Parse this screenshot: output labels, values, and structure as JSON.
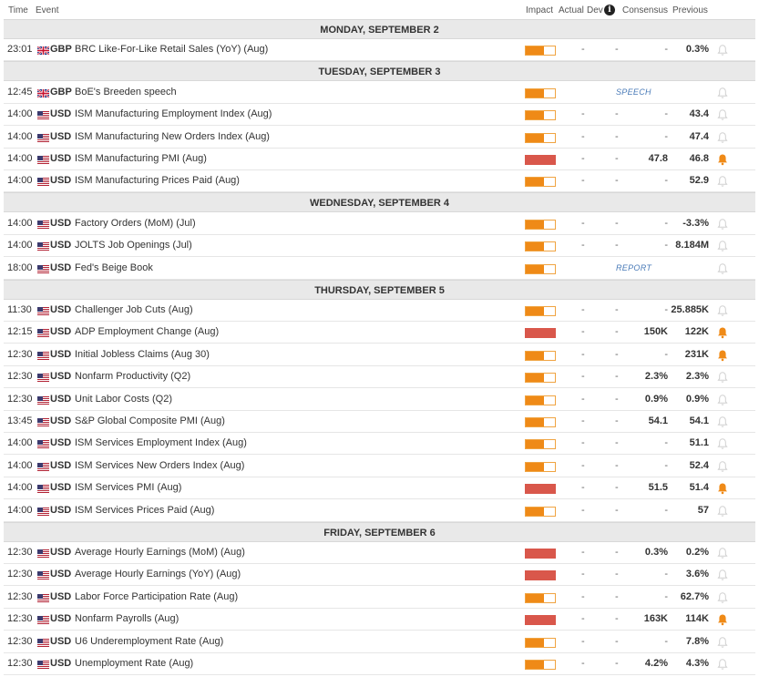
{
  "header": {
    "time": "Time",
    "event": "Event",
    "impact": "Impact",
    "actual": "Actual",
    "dev": "Dev",
    "consensus": "Consensus",
    "previous": "Previous",
    "info_icon": "i"
  },
  "colors": {
    "impact_medium": "#ef8a17",
    "impact_high": "#d9574b",
    "bell_active": "#ef8a17",
    "bell_inactive": "#d0d0d0",
    "tag_text": "#4a7bb8"
  },
  "days": [
    {
      "label": "MONDAY, SEPTEMBER 2",
      "events": [
        {
          "time": "23:01",
          "currency": "GBP",
          "flag": "uk-flag-icon",
          "event": "BRC Like-For-Like Retail Sales (YoY) (Aug)",
          "impact": "medium",
          "actual": "-",
          "dev": "-",
          "consensus": "-",
          "previous": "0.3%",
          "alert": false
        }
      ]
    },
    {
      "label": "TUESDAY, SEPTEMBER 3",
      "events": [
        {
          "time": "12:45",
          "currency": "GBP",
          "flag": "uk-flag-icon",
          "event": "BoE's Breeden speech",
          "impact": "medium",
          "tag": "SPEECH",
          "alert": false
        },
        {
          "time": "14:00",
          "currency": "USD",
          "flag": "us-flag-icon",
          "event": "ISM Manufacturing Employment Index (Aug)",
          "impact": "medium",
          "actual": "-",
          "dev": "-",
          "consensus": "-",
          "previous": "43.4",
          "alert": false
        },
        {
          "time": "14:00",
          "currency": "USD",
          "flag": "us-flag-icon",
          "event": "ISM Manufacturing New Orders Index (Aug)",
          "impact": "medium",
          "actual": "-",
          "dev": "-",
          "consensus": "-",
          "previous": "47.4",
          "alert": false
        },
        {
          "time": "14:00",
          "currency": "USD",
          "flag": "us-flag-icon",
          "event": "ISM Manufacturing PMI (Aug)",
          "impact": "high",
          "actual": "-",
          "dev": "-",
          "consensus": "47.8",
          "previous": "46.8",
          "alert": true
        },
        {
          "time": "14:00",
          "currency": "USD",
          "flag": "us-flag-icon",
          "event": "ISM Manufacturing Prices Paid (Aug)",
          "impact": "medium",
          "actual": "-",
          "dev": "-",
          "consensus": "-",
          "previous": "52.9",
          "alert": false
        }
      ]
    },
    {
      "label": "WEDNESDAY, SEPTEMBER 4",
      "events": [
        {
          "time": "14:00",
          "currency": "USD",
          "flag": "us-flag-icon",
          "event": "Factory Orders (MoM) (Jul)",
          "impact": "medium",
          "actual": "-",
          "dev": "-",
          "consensus": "-",
          "previous": "-3.3%",
          "alert": false
        },
        {
          "time": "14:00",
          "currency": "USD",
          "flag": "us-flag-icon",
          "event": "JOLTS Job Openings (Jul)",
          "impact": "medium",
          "actual": "-",
          "dev": "-",
          "consensus": "-",
          "previous": "8.184M",
          "alert": false
        },
        {
          "time": "18:00",
          "currency": "USD",
          "flag": "us-flag-icon",
          "event": "Fed's Beige Book",
          "impact": "medium",
          "tag": "REPORT",
          "alert": false
        }
      ]
    },
    {
      "label": "THURSDAY, SEPTEMBER 5",
      "events": [
        {
          "time": "11:30",
          "currency": "USD",
          "flag": "us-flag-icon",
          "event": "Challenger Job Cuts (Aug)",
          "impact": "medium",
          "actual": "-",
          "dev": "-",
          "consensus": "-",
          "previous": "25.885K",
          "alert": false
        },
        {
          "time": "12:15",
          "currency": "USD",
          "flag": "us-flag-icon",
          "event": "ADP Employment Change (Aug)",
          "impact": "high",
          "actual": "-",
          "dev": "-",
          "consensus": "150K",
          "previous": "122K",
          "alert": true
        },
        {
          "time": "12:30",
          "currency": "USD",
          "flag": "us-flag-icon",
          "event": "Initial Jobless Claims (Aug 30)",
          "impact": "medium",
          "actual": "-",
          "dev": "-",
          "consensus": "-",
          "previous": "231K",
          "alert": true
        },
        {
          "time": "12:30",
          "currency": "USD",
          "flag": "us-flag-icon",
          "event": "Nonfarm Productivity (Q2)",
          "impact": "medium",
          "actual": "-",
          "dev": "-",
          "consensus": "2.3%",
          "previous": "2.3%",
          "alert": false
        },
        {
          "time": "12:30",
          "currency": "USD",
          "flag": "us-flag-icon",
          "event": "Unit Labor Costs (Q2)",
          "impact": "medium",
          "actual": "-",
          "dev": "-",
          "consensus": "0.9%",
          "previous": "0.9%",
          "alert": false
        },
        {
          "time": "13:45",
          "currency": "USD",
          "flag": "us-flag-icon",
          "event": "S&P Global Composite PMI (Aug)",
          "impact": "medium",
          "actual": "-",
          "dev": "-",
          "consensus": "54.1",
          "previous": "54.1",
          "alert": false
        },
        {
          "time": "14:00",
          "currency": "USD",
          "flag": "us-flag-icon",
          "event": "ISM Services Employment Index (Aug)",
          "impact": "medium",
          "actual": "-",
          "dev": "-",
          "consensus": "-",
          "previous": "51.1",
          "alert": false
        },
        {
          "time": "14:00",
          "currency": "USD",
          "flag": "us-flag-icon",
          "event": "ISM Services New Orders Index (Aug)",
          "impact": "medium",
          "actual": "-",
          "dev": "-",
          "consensus": "-",
          "previous": "52.4",
          "alert": false
        },
        {
          "time": "14:00",
          "currency": "USD",
          "flag": "us-flag-icon",
          "event": "ISM Services PMI (Aug)",
          "impact": "high",
          "actual": "-",
          "dev": "-",
          "consensus": "51.5",
          "previous": "51.4",
          "alert": true
        },
        {
          "time": "14:00",
          "currency": "USD",
          "flag": "us-flag-icon",
          "event": "ISM Services Prices Paid (Aug)",
          "impact": "medium",
          "actual": "-",
          "dev": "-",
          "consensus": "-",
          "previous": "57",
          "alert": false
        }
      ]
    },
    {
      "label": "FRIDAY, SEPTEMBER 6",
      "events": [
        {
          "time": "12:30",
          "currency": "USD",
          "flag": "us-flag-icon",
          "event": "Average Hourly Earnings (MoM) (Aug)",
          "impact": "high",
          "actual": "-",
          "dev": "-",
          "consensus": "0.3%",
          "previous": "0.2%",
          "alert": false
        },
        {
          "time": "12:30",
          "currency": "USD",
          "flag": "us-flag-icon",
          "event": "Average Hourly Earnings (YoY) (Aug)",
          "impact": "high",
          "actual": "-",
          "dev": "-",
          "consensus": "-",
          "previous": "3.6%",
          "alert": false
        },
        {
          "time": "12:30",
          "currency": "USD",
          "flag": "us-flag-icon",
          "event": "Labor Force Participation Rate (Aug)",
          "impact": "medium",
          "actual": "-",
          "dev": "-",
          "consensus": "-",
          "previous": "62.7%",
          "alert": false
        },
        {
          "time": "12:30",
          "currency": "USD",
          "flag": "us-flag-icon",
          "event": "Nonfarm Payrolls (Aug)",
          "impact": "high",
          "actual": "-",
          "dev": "-",
          "consensus": "163K",
          "previous": "114K",
          "alert": true
        },
        {
          "time": "12:30",
          "currency": "USD",
          "flag": "us-flag-icon",
          "event": "U6 Underemployment Rate (Aug)",
          "impact": "medium",
          "actual": "-",
          "dev": "-",
          "consensus": "-",
          "previous": "7.8%",
          "alert": false
        },
        {
          "time": "12:30",
          "currency": "USD",
          "flag": "us-flag-icon",
          "event": "Unemployment Rate (Aug)",
          "impact": "medium",
          "actual": "-",
          "dev": "-",
          "consensus": "4.2%",
          "previous": "4.3%",
          "alert": false
        }
      ]
    }
  ]
}
